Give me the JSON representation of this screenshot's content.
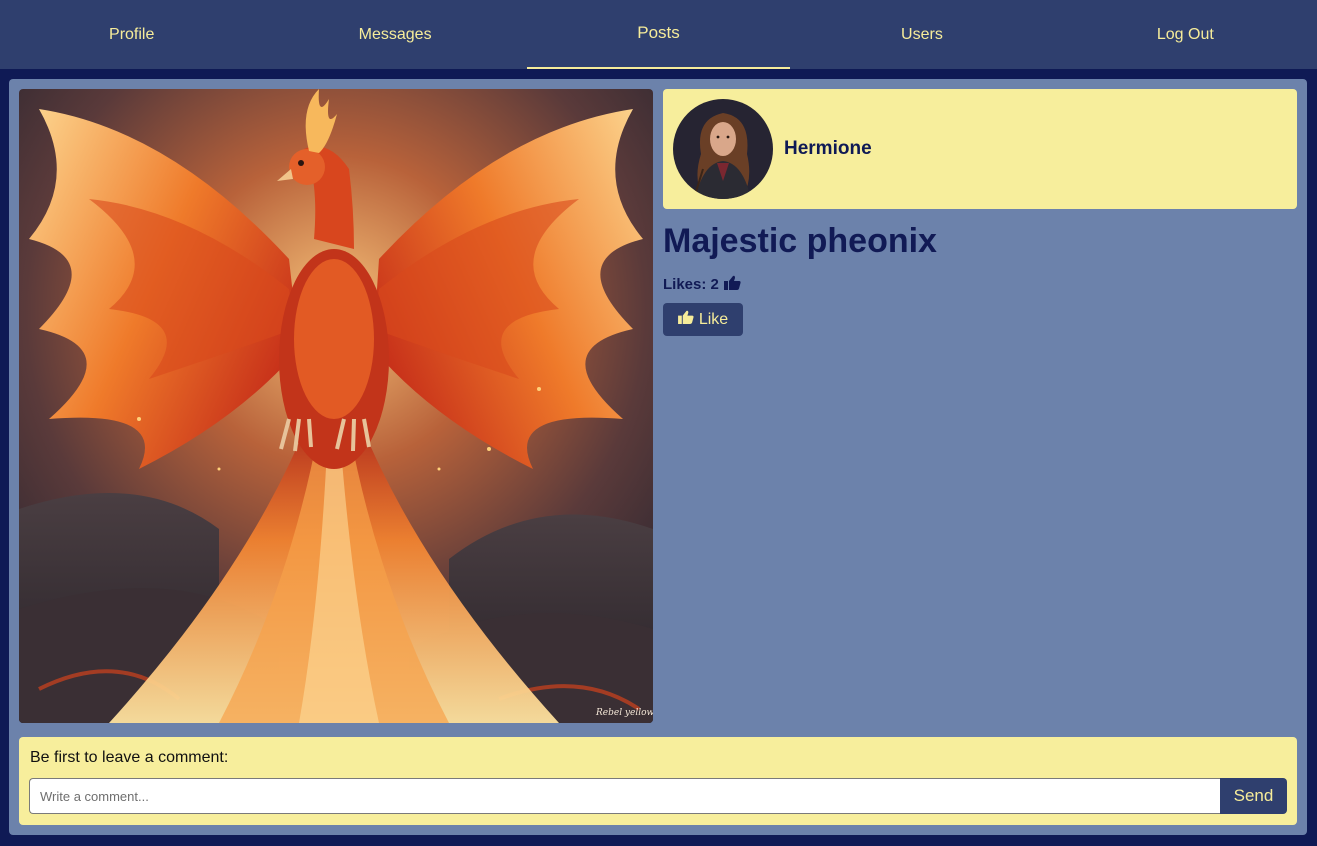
{
  "nav": {
    "items": [
      {
        "label": "Profile"
      },
      {
        "label": "Messages"
      },
      {
        "label": "Posts"
      },
      {
        "label": "Users"
      },
      {
        "label": "Log Out"
      }
    ],
    "active": "Posts"
  },
  "post": {
    "author": {
      "name": "Hermione"
    },
    "title": "Majestic pheonix",
    "likes_label": "Likes:",
    "likes_count": "2",
    "like_button_label": "Like",
    "image_signature": "Rebel yellow"
  },
  "comments": {
    "prompt": "Be first to leave a comment:",
    "input_placeholder": "Write a comment...",
    "send_label": "Send"
  },
  "colors": {
    "page_background": "#0f1a55",
    "navbar": "#2f3f6e",
    "accent_text": "#f6ec9a",
    "card_background": "#6c82ab",
    "panel_background": "#f7ee9c",
    "title_text": "#111a55"
  },
  "icons": {
    "likes": "thumbs-up-icon",
    "like_button": "thumbs-up-icon"
  }
}
